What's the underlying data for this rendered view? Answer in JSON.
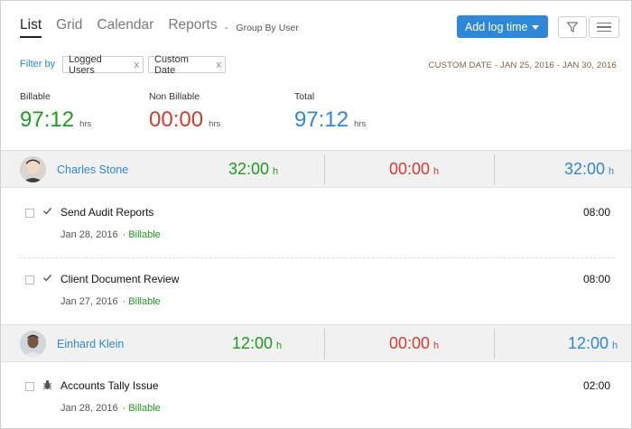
{
  "nav": {
    "tabs": [
      {
        "label": "List",
        "active": true
      },
      {
        "label": "Grid",
        "active": false
      },
      {
        "label": "Calendar",
        "active": false
      },
      {
        "label": "Reports",
        "active": false
      }
    ],
    "group_by_dash": "-",
    "group_by": "Group By User"
  },
  "toolbar": {
    "add_button": "Add log time",
    "filter_icon": "filter-icon",
    "menu_icon": "menu-icon"
  },
  "filters": {
    "label": "Filter by",
    "chips": [
      {
        "label": "Logged Users",
        "remove": "x"
      },
      {
        "label": "Custom Date",
        "remove": "x"
      }
    ],
    "date_range": "CUSTOM DATE - JAN 25, 2016 - JAN 30, 2016"
  },
  "summary": {
    "billable": {
      "label": "Billable",
      "value": "97:12",
      "unit": "hrs"
    },
    "non_billable": {
      "label": "Non Billable",
      "value": "00:00",
      "unit": "hrs"
    },
    "total": {
      "label": "Total",
      "value": "97:12",
      "unit": "hrs"
    }
  },
  "groups": [
    {
      "user": "Charles Stone",
      "billable": "32:00",
      "non_billable": "00:00",
      "total": "32:00",
      "unit": "h",
      "tasks": [
        {
          "name": "Send Audit Reports",
          "date": "Jan 28, 2016",
          "dot": "·",
          "status": "Billable",
          "time": "08:00",
          "icon": "check-icon"
        },
        {
          "name": "Client Document Review",
          "date": "Jan 27, 2016",
          "dot": "·",
          "status": "Billable",
          "time": "08:00",
          "icon": "check-icon"
        }
      ]
    },
    {
      "user": "Einhard Klein",
      "billable": "12:00",
      "non_billable": "00:00",
      "total": "12:00",
      "unit": "h",
      "tasks": [
        {
          "name": "Accounts Tally Issue",
          "date": "Jan 28, 2016",
          "dot": "·",
          "status": "Billable",
          "time": "02:00",
          "icon": "bug-icon"
        }
      ]
    }
  ],
  "colors": {
    "accent": "#2f87d8",
    "billable": "#1e9c1e",
    "non_billable": "#d43c2b",
    "date_range": "#8a5a3c"
  }
}
